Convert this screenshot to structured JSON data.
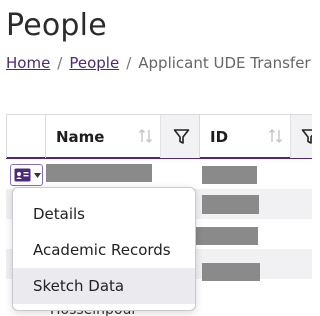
{
  "page": {
    "title": "People"
  },
  "breadcrumb": {
    "items": [
      {
        "label": "Home",
        "link": true
      },
      {
        "label": "People",
        "link": true
      },
      {
        "label": "Applicant UDE Transfer",
        "link": false
      }
    ],
    "separator": "/"
  },
  "grid": {
    "columns": [
      {
        "label": "Name",
        "sortable": true,
        "filterable": true
      },
      {
        "label": "ID",
        "sortable": true,
        "filterable": true
      }
    ],
    "rows": [
      {
        "name": "",
        "id": "",
        "redacted": true
      },
      {
        "name": "",
        "id": "",
        "redacted": true
      },
      {
        "name": "",
        "id": "",
        "redacted": true
      },
      {
        "name": "",
        "id": "",
        "redacted": true
      }
    ],
    "partial_name_below_menu": "Hosseinpour"
  },
  "action_menu": {
    "icons": [
      "id-card-icon",
      "caret-down-icon"
    ],
    "items": [
      {
        "label": "Details",
        "hovered": false
      },
      {
        "label": "Academic Records",
        "hovered": false
      },
      {
        "label": "Sketch Data",
        "hovered": true
      }
    ]
  },
  "colors": {
    "accent": "#4b2a7a",
    "redaction": "#8a8a8a",
    "menu_hover": "#ebebef",
    "row_alt": "#f1f1f4"
  }
}
